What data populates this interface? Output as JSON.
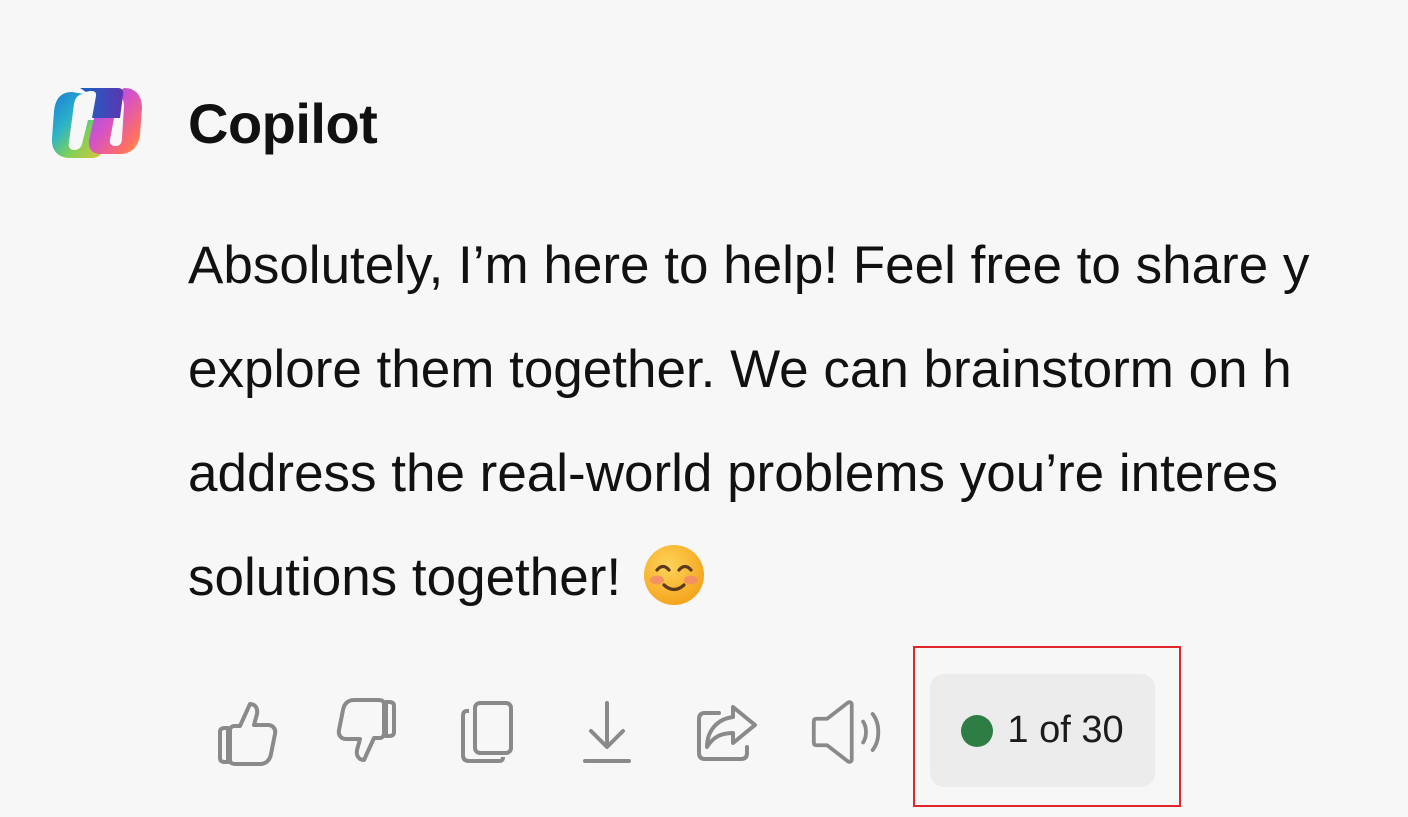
{
  "assistant": {
    "name": "Copilot",
    "logo_icon": "copilot-logo-icon"
  },
  "message": {
    "lines": [
      "Absolutely, I’m here to help! Feel free to share y",
      "explore them together. We can brainstorm on h",
      "address the real-world problems you’re interes",
      "solutions together!"
    ],
    "emoji": "smiling-face-icon"
  },
  "actions": [
    {
      "name": "like-button",
      "icon": "thumbs-up-icon"
    },
    {
      "name": "dislike-button",
      "icon": "thumbs-down-icon"
    },
    {
      "name": "copy-button",
      "icon": "copy-icon"
    },
    {
      "name": "export-button",
      "icon": "download-icon"
    },
    {
      "name": "share-button",
      "icon": "share-icon"
    },
    {
      "name": "read-aloud-button",
      "icon": "speaker-icon"
    }
  ],
  "response_counter": {
    "text": "1 of 30",
    "status_color": "#2e7d45"
  },
  "colors": {
    "background": "#f7f7f7",
    "text": "#111111",
    "icon": "#8a8a8a",
    "highlight": "#e0262b"
  }
}
